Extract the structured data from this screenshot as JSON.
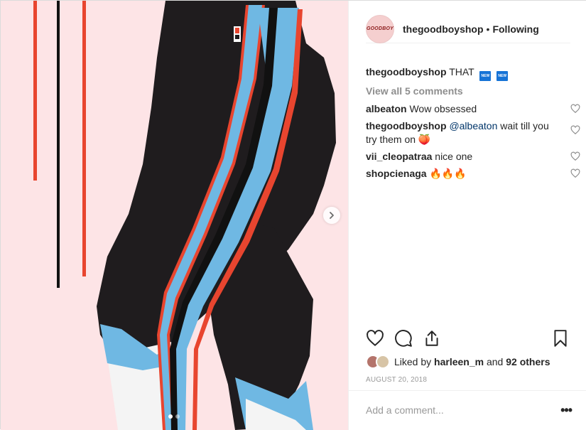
{
  "post": {
    "username": "thegoodboyshop",
    "separator": "•",
    "follow_state": "Following",
    "avatar_text": "GOODBOY",
    "caption": {
      "username": "thegoodboyshop",
      "text": "THAT",
      "badges": [
        "NEW",
        "NEW"
      ]
    },
    "view_all_comments": "View all 5 comments",
    "comments": [
      {
        "username": "albeaton",
        "text": "Wow obsessed"
      },
      {
        "username": "thegoodboyshop",
        "mention": "@albeaton",
        "text": "wait till you try them on 🍑"
      },
      {
        "username": "vii_cleopatraa",
        "text": "nice one"
      },
      {
        "username": "shopcienaga",
        "text": "🔥🔥🔥"
      }
    ],
    "likes": {
      "prefix": "Liked by",
      "user": "harleen_m",
      "and": "and",
      "others": "92 others"
    },
    "date": "AUGUST 20, 2018",
    "add_comment_placeholder": "Add a comment...",
    "more_label": "•••",
    "carousel": {
      "count": 2,
      "active_index": 0
    }
  },
  "icons": {
    "like": "heart-icon",
    "comment": "comment-icon",
    "share": "share-icon",
    "save": "bookmark-icon",
    "next": "chevron-right-icon"
  },
  "colors": {
    "background": "#fde4e6",
    "legging": "#1f1c1e",
    "stripe_blue": "#6fb8e3",
    "stripe_red": "#e8452f",
    "mention": "#003569",
    "muted": "#8e8e8e"
  }
}
